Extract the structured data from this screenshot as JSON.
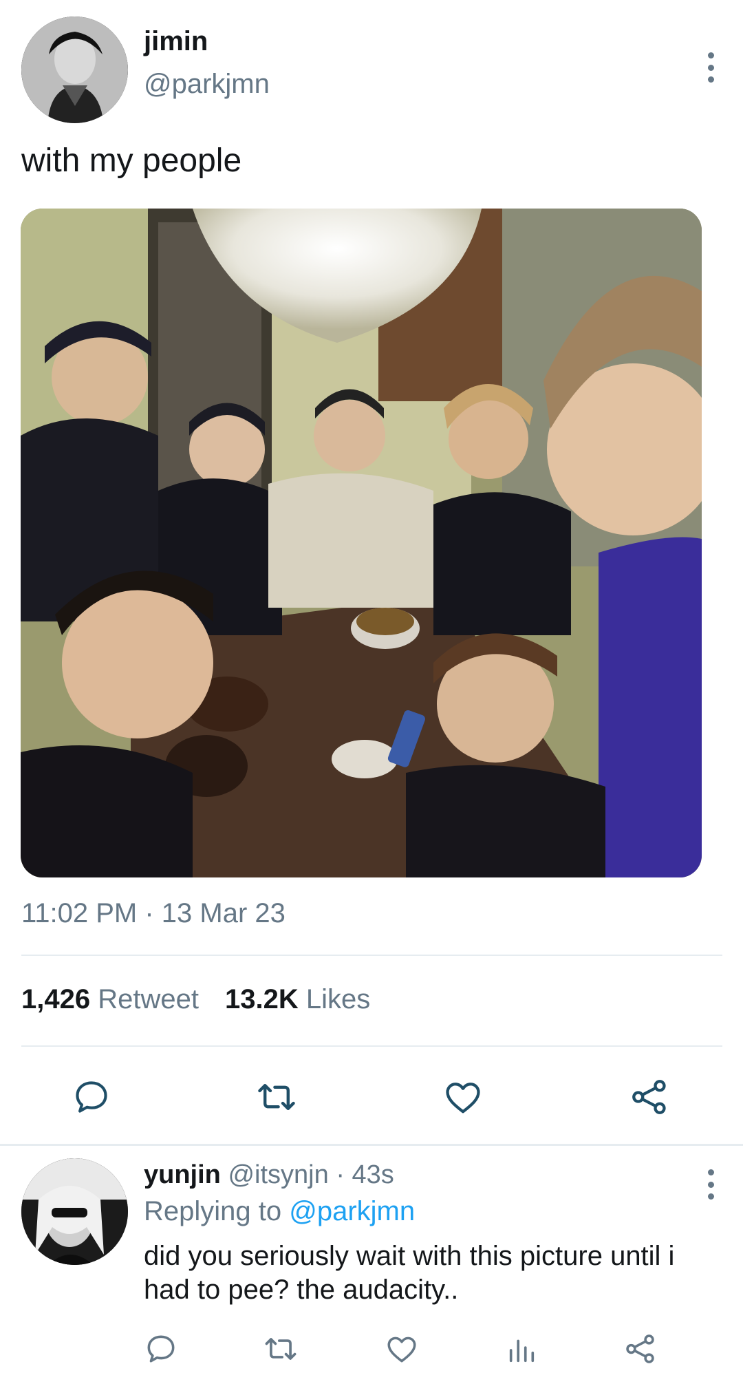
{
  "main_tweet": {
    "author_name": "jimin",
    "author_handle": "@parkjmn",
    "text": "with my people",
    "timestamp": "11:02 PM · 13 Mar 23",
    "stats": {
      "retweets_count": "1,426",
      "retweets_label": "Retweet",
      "likes_count": "13.2K",
      "likes_label": "Likes"
    },
    "actions": [
      "reply-icon",
      "retweet-icon",
      "like-icon",
      "share-icon"
    ]
  },
  "reply": {
    "author_name": "yunjin",
    "author_handle": "@itsynjn",
    "time": "· 43s",
    "replying_prefix": "Replying to",
    "replying_to": "@parkjmn",
    "text": "did you seriously wait with this picture until i had to pee? the audacity..",
    "actions": [
      "reply-icon",
      "retweet-icon",
      "like-icon",
      "analytics-icon",
      "share-icon"
    ]
  },
  "colors": {
    "text_primary": "#14171a",
    "text_secondary": "#657786",
    "link": "#1da1f2",
    "divider": "#e6ecf0",
    "icon": "#1f4e67"
  }
}
